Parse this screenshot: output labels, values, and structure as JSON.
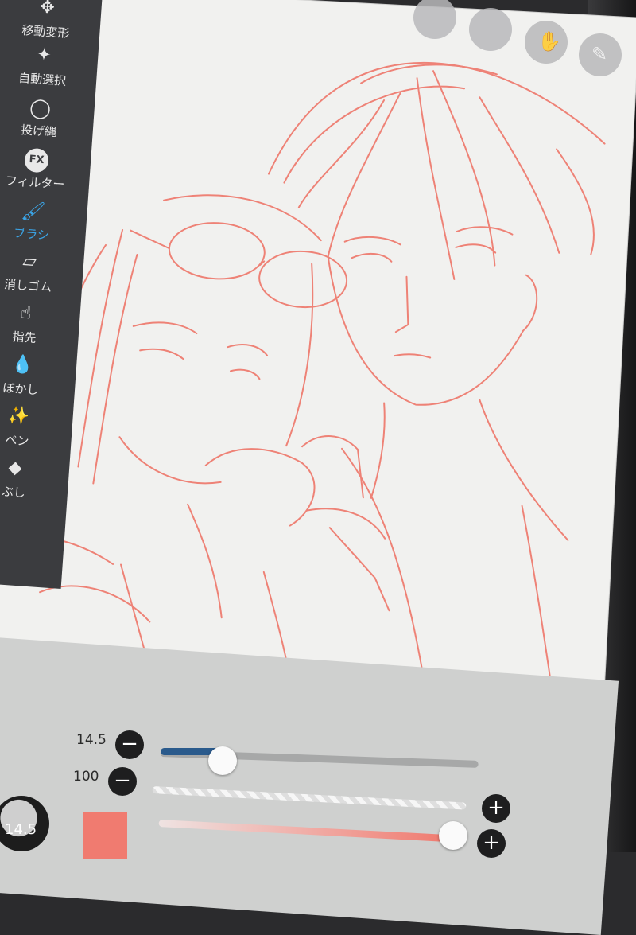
{
  "toolbar": {
    "tools": [
      {
        "label": "移動変形",
        "icon": "move-icon"
      },
      {
        "label": "自動選択",
        "icon": "magic-wand-icon"
      },
      {
        "label": "投げ縄",
        "icon": "lasso-icon"
      },
      {
        "label": "フィルター",
        "icon": "fx-icon",
        "badge": "FX"
      },
      {
        "label": "ブラシ",
        "icon": "brush-icon",
        "active": true
      },
      {
        "label": "消しゴム",
        "icon": "eraser-icon"
      },
      {
        "label": "指先",
        "icon": "finger-icon"
      },
      {
        "label": "ぼかし",
        "icon": "blur-drop-icon"
      },
      {
        "label": "ペン",
        "icon": "sparkle-pen-icon"
      },
      {
        "label": "ぶし",
        "icon": "fill-icon"
      }
    ],
    "active_color": "#3ba4e6"
  },
  "top_buttons": [
    "toggle-icon",
    "selection-icon",
    "hand-icon",
    "pen-icon"
  ],
  "brush_panel": {
    "size_value": "14.5",
    "size_fraction": 0.2,
    "opacity_value": "100",
    "opacity_fraction": 1.0,
    "preview_size": "14.5",
    "minus": "−",
    "plus": "+",
    "color": "#f07b70"
  },
  "colors": {
    "sketch_line": "#ee6f62",
    "slider_fill": "#2a5a8c"
  }
}
